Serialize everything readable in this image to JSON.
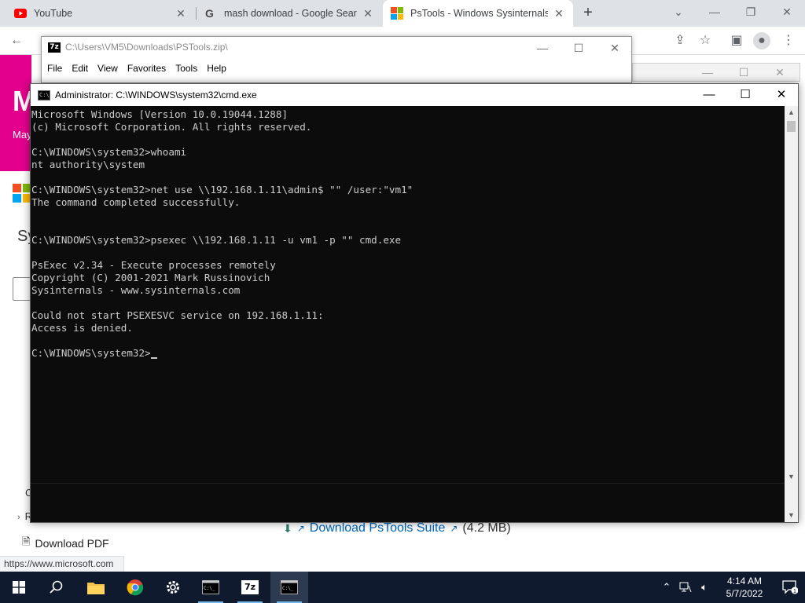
{
  "browser": {
    "tabs": [
      {
        "title": "YouTube",
        "close": "✕"
      },
      {
        "title": "mash download - Google Search",
        "close": "✕"
      },
      {
        "title": "PsTools - Windows Sysinternals |",
        "close": "✕"
      }
    ],
    "new_tab": "+",
    "status_url": "https://www.microsoft.com",
    "colors": {
      "tabstrip": "#dee1e6",
      "link": "#0067b8",
      "banner": "#e3008c"
    }
  },
  "page": {
    "banner_letter": "M",
    "banner_sub": "May",
    "heading_fragment": "Sy",
    "c_fragment": "C",
    "r_fragment": "R",
    "download_pdf": "Download PDF",
    "download_suite": "Download PsTools Suite",
    "suite_size": "(4.2 MB)"
  },
  "sevenzip": {
    "title": "C:\\Users\\VM5\\Downloads\\PSTools.zip\\",
    "icon_label": "7z",
    "menu": [
      "File",
      "Edit",
      "View",
      "Favorites",
      "Tools",
      "Help"
    ]
  },
  "cmd": {
    "title": "Administrator: C:\\WINDOWS\\system32\\cmd.exe",
    "lines": [
      "Microsoft Windows [Version 10.0.19044.1288]",
      "(c) Microsoft Corporation. All rights reserved.",
      "",
      "C:\\WINDOWS\\system32>whoami",
      "nt authority\\system",
      "",
      "C:\\WINDOWS\\system32>net use \\\\192.168.1.11\\admin$ \"\" /user:\"vm1\"",
      "The command completed successfully.",
      "",
      "",
      "C:\\WINDOWS\\system32>psexec \\\\192.168.1.11 -u vm1 -p \"\" cmd.exe",
      "",
      "PsExec v2.34 - Execute processes remotely",
      "Copyright (C) 2001-2021 Mark Russinovich",
      "Sysinternals - www.sysinternals.com",
      "",
      "Could not start PSEXESVC service on 192.168.1.11:",
      "Access is denied.",
      ""
    ],
    "prompt": "C:\\WINDOWS\\system32>"
  },
  "taskbar": {
    "items": [
      "start-icon",
      "search-icon",
      "file-explorer-icon",
      "chrome-icon",
      "settings-icon",
      "cmd-icon",
      "7zip-icon",
      "cmd-icon"
    ],
    "zip_label": "7z",
    "time": "4:14 AM",
    "date": "5/7/2022",
    "notification_count": "1"
  }
}
